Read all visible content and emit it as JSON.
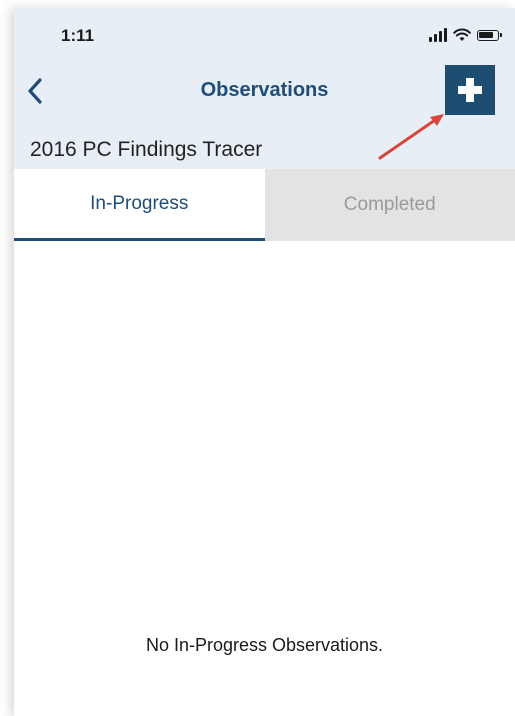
{
  "status_bar": {
    "time": "1:11",
    "signal_icon": "signal-bars-icon",
    "wifi_icon": "wifi-icon",
    "battery_icon": "battery-icon"
  },
  "nav": {
    "back_icon": "chevron-left-icon",
    "title": "Observations",
    "add_icon": "plus-icon"
  },
  "subtitle": "2016 PC Findings Tracer",
  "tabs": [
    {
      "label": "In-Progress",
      "active": true
    },
    {
      "label": "Completed",
      "active": false
    }
  ],
  "empty_message": "No In-Progress Observations.",
  "colors": {
    "accent": "#1e4d7a",
    "header_bg": "#e8eef6",
    "inactive_tab_bg": "#e3e3e3",
    "annotation_arrow": "#d9453b"
  }
}
